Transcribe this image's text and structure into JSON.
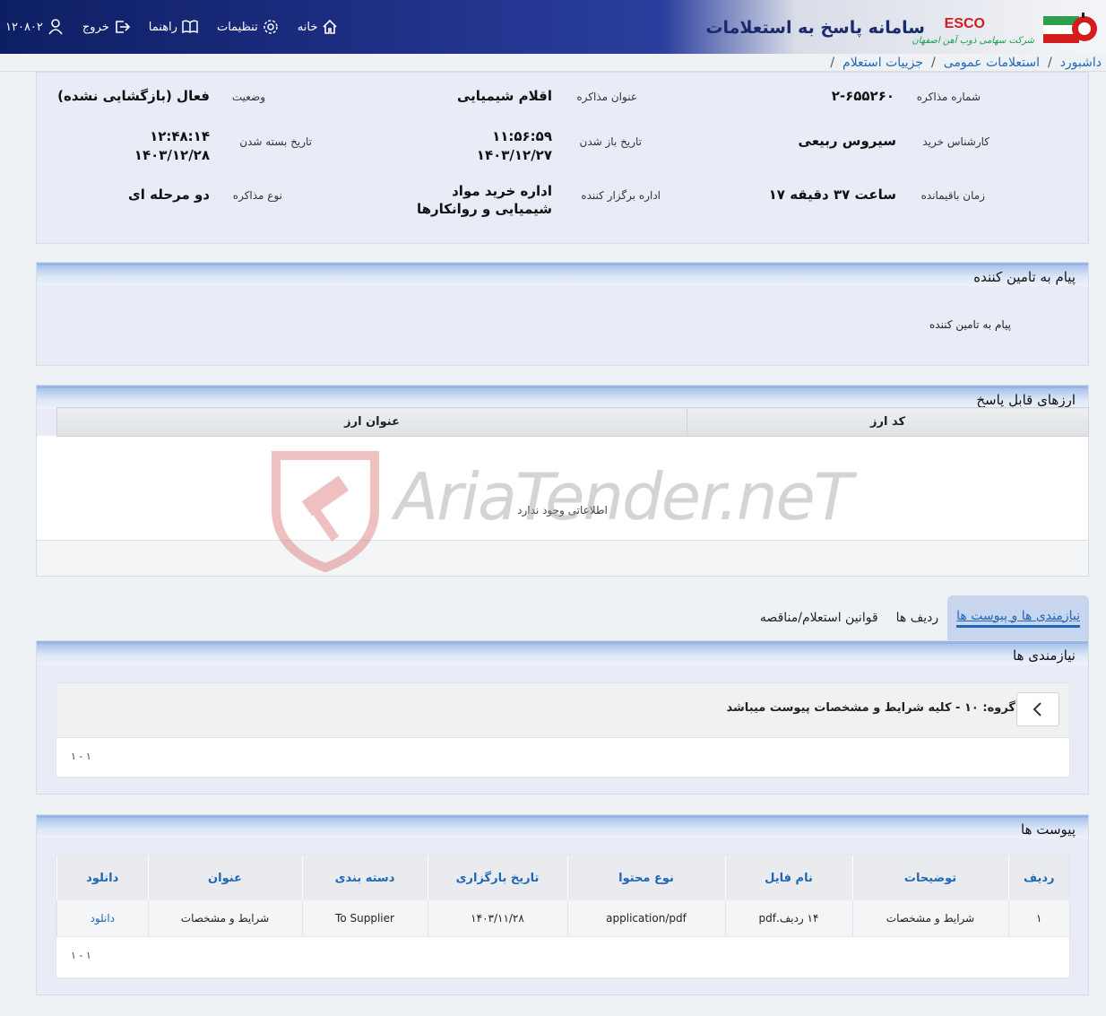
{
  "header": {
    "title": "سامانه پاسخ به استعلامات",
    "brand": "ESCO",
    "company": "شرکت سهامی ذوب آهن اصفهان",
    "nav": {
      "home": "خانه",
      "settings": "تنظیمات",
      "help": "راهنما",
      "logout": "خروج",
      "user_code": "۱۲۰۸۰۲"
    }
  },
  "breadcrumb": [
    "داشبورد",
    "استعلامات عمومی",
    "جزییات استعلام"
  ],
  "info": {
    "number_label": "شماره مذاکره",
    "number_value": "۲-۶۵۵۲۶۰",
    "title_label": "عنوان مذاکره",
    "title_value": "اقلام شیمیایی",
    "status_label": "وضعیت",
    "status_value": "فعال (بازگشایی نشده)",
    "buyer_label": "کارشناس خرید",
    "buyer_value": "سیروس ربیعی",
    "open_label": "تاریخ باز شدن",
    "open_time": "۱۱:۵۶:۵۹",
    "open_date": "۱۴۰۳/۱۲/۲۷",
    "close_label": "تاریخ بسته شدن",
    "close_time": "۱۲:۴۸:۱۴",
    "close_date": "۱۴۰۳/۱۲/۲۸",
    "remaining_label": "زمان باقیمانده",
    "remaining_value": "۱۷ ساعت ۳۷ دقیقه",
    "org_label": "اداره برگزار کننده",
    "org_value": "اداره خرید مواد شیمیایی و روانکارها",
    "type_label": "نوع مذاکره",
    "type_value": "دو مرحله ای"
  },
  "message": {
    "heading": "پیام به تامین کننده",
    "label": "پیام به تامین کننده"
  },
  "currencies": {
    "heading": "ارزهای قابل پاسخ",
    "columns": [
      "کد ارز",
      "عنوان ارز"
    ],
    "empty_text": "اطلاعاتی وجود ندارد"
  },
  "tabs": [
    "نیازمندی ها و پیوست ها",
    "ردیف ها",
    "قوانین استعلام/مناقصه"
  ],
  "needs": {
    "heading": "نیازمندی ها",
    "group_text": "گروه: ۱۰ - کلیه شرایط و مشخصات پیوست میباشد",
    "pager": "۱ - ۱"
  },
  "attachments": {
    "heading": "پیوست ها",
    "columns": [
      "ردیف",
      "توضیحات",
      "نام فایل",
      "نوع محتوا",
      "تاریخ بارگزاری",
      "دسته بندی",
      "عنوان",
      "دانلود"
    ],
    "rows": [
      [
        "۱",
        "شرایط و مشخصات",
        "۱۴ ردیف.pdf",
        "application/pdf",
        "۱۴۰۳/۱۱/۲۸",
        "To Supplier",
        "شرایط و مشخصات",
        "دانلود"
      ]
    ],
    "pager": "۱ - ۱"
  },
  "watermark": "AriaTender.neT",
  "colors": {
    "header_dark": "#0d1f63",
    "link_blue": "#1f68b8",
    "panel_bg": "#e9ebf6",
    "section_head": "#a9c3ea",
    "esco_red": "#d31d1d",
    "company_green": "#1aa04a"
  }
}
